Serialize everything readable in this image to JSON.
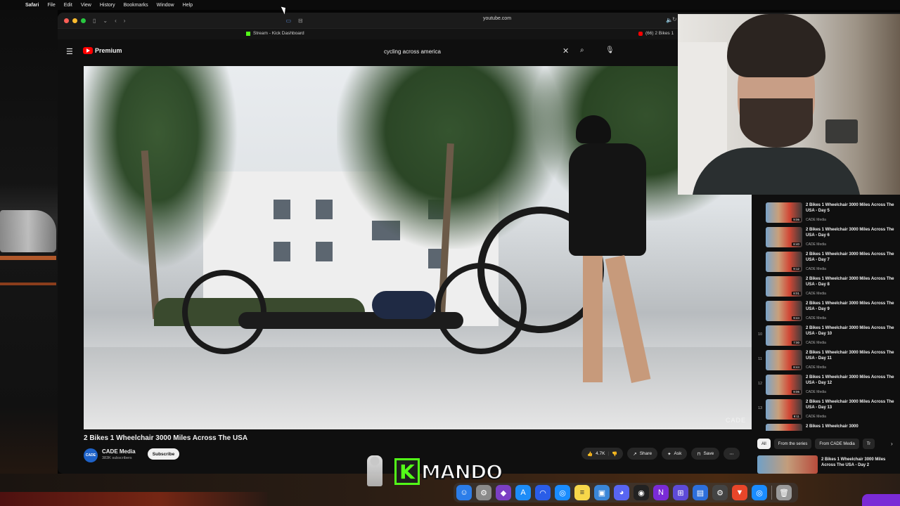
{
  "menubar": {
    "app": "Safari",
    "items": [
      "File",
      "Edit",
      "View",
      "History",
      "Bookmarks",
      "Window",
      "Help"
    ]
  },
  "browser": {
    "url": "youtube.com",
    "tabs": [
      {
        "label": "Stream - Kick Dashboard"
      },
      {
        "label": "(66) 2 Bikes 1"
      }
    ]
  },
  "youtube": {
    "logo_text": "Premium",
    "search_query": "cycling across america",
    "video": {
      "watermark": "CADE",
      "title": "2 Bikes 1 Wheelchair 3000 Miles Across The USA",
      "channel": "CADE Media",
      "channel_avatar": "CADE",
      "subscribers": "383K subscribers",
      "subscribe_label": "Subscribe",
      "likes": "4.7K",
      "share_label": "Share",
      "ask_label": "Ask",
      "save_label": "Save"
    },
    "playlist": [
      {
        "num": "",
        "title": "2 Bikes 1 Wheelchair 3000 Miles Across The USA - Day 5",
        "channel": "CADE Media",
        "duration": "9:06"
      },
      {
        "num": "",
        "title": "2 Bikes 1 Wheelchair 3000 Miles Across The USA - Day 6",
        "channel": "CADE Media",
        "duration": "8:40"
      },
      {
        "num": "",
        "title": "2 Bikes 1 Wheelchair 3000 Miles Across The USA - Day 7",
        "channel": "CADE Media",
        "duration": "9:12"
      },
      {
        "num": "",
        "title": "2 Bikes 1 Wheelchair 3000 Miles Across The USA - Day 8",
        "channel": "CADE Media",
        "duration": "8:01"
      },
      {
        "num": "",
        "title": "2 Bikes 1 Wheelchair 3000 Miles Across The USA - Day 9",
        "channel": "CADE Media",
        "duration": "9:44"
      },
      {
        "num": "10",
        "title": "2 Bikes 1 Wheelchair 3000 Miles Across The USA - Day 10",
        "channel": "CADE Media",
        "duration": "7:00"
      },
      {
        "num": "11",
        "title": "2 Bikes 1 Wheelchair 3000 Miles Across The USA - Day 11",
        "channel": "CADE Media",
        "duration": "8:44"
      },
      {
        "num": "12",
        "title": "2 Bikes 1 Wheelchair 3000 Miles Across The USA - Day 12",
        "channel": "CADE Media",
        "duration": "9:06"
      },
      {
        "num": "13",
        "title": "2 Bikes 1 Wheelchair 3000 Miles Across The USA - Day 13",
        "channel": "CADE Media",
        "duration": "9:11"
      },
      {
        "num": "14",
        "title": "2 Bikes 1 Wheelchair 3000",
        "channel": "",
        "duration": ""
      }
    ],
    "chips": [
      "All",
      "From the series",
      "From CADE Media",
      "Tr"
    ],
    "recommendation": {
      "title": "2 Bikes 1 Wheelchair 3000 Miles Across The USA - Day 2"
    }
  },
  "overlay": {
    "kick_letter": "K",
    "kick_name": "MANDO"
  },
  "dock": {
    "apps": [
      "finder-icon",
      "launchpad-icon",
      "brave-icon",
      "app-store-icon",
      "arc-icon",
      "safari-icon",
      "notes-icon",
      "preview-icon",
      "discord-icon",
      "obs-icon",
      "news-icon",
      "grid-icon",
      "messages-icon",
      "settings-icon",
      "brave-browser-icon",
      "safari-dock-icon",
      "trash-icon"
    ]
  },
  "colors": {
    "kick_green": "#53fc18",
    "youtube_red": "#ff0000",
    "background": "#0f0f0f"
  }
}
